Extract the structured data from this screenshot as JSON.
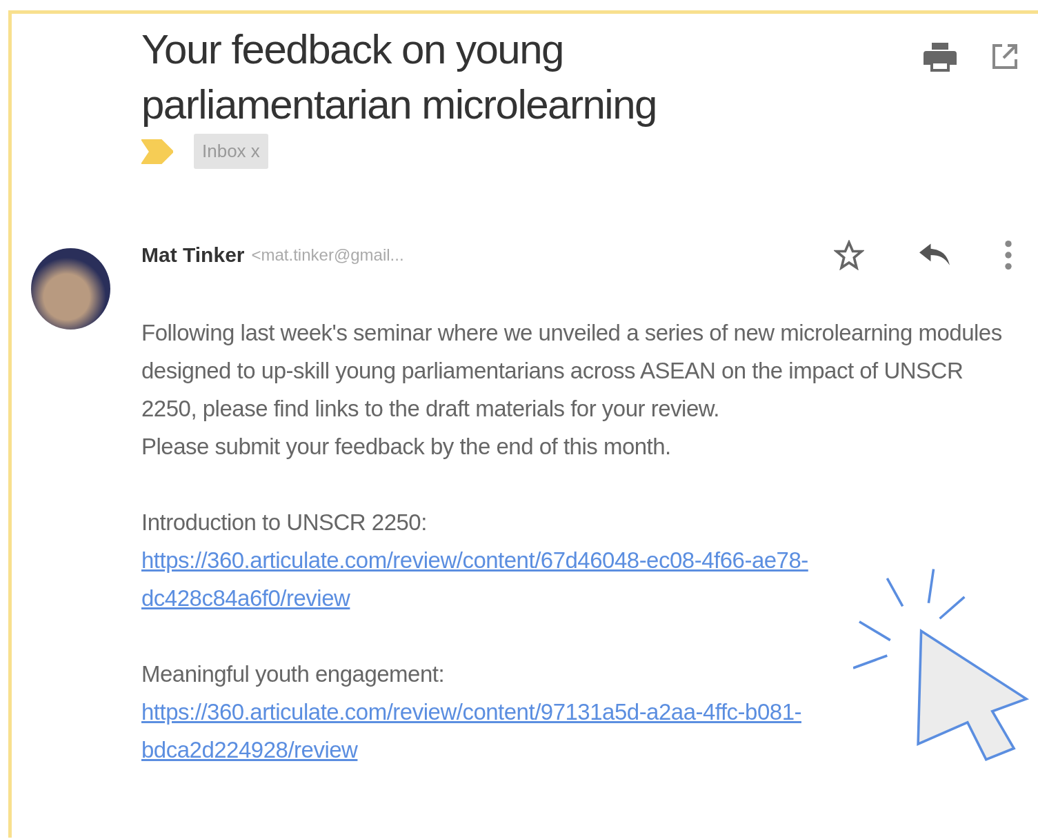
{
  "email": {
    "subject": "Your feedback on young parliamentarian microlearning",
    "important": true,
    "labels": [
      {
        "text": "Inbox",
        "close": "x"
      }
    ],
    "sender": {
      "name": "Mat Tinker",
      "address": "<mat.tinker@gmail..."
    },
    "starred": false,
    "body": [
      "Following last week's seminar where we unveiled a series of new microlearning modules designed to up-skill young parliamentarians across ASEAN on the impact of UNSCR 2250, please find links to the draft materials for your review.",
      "Please submit your feedback by the end of this month."
    ],
    "links": [
      {
        "title": "Introduction to UNSCR 2250:",
        "url": "https://360.articulate.com/review/content/67d46048-ec08-4f66-ae78-dc428c84a6f0/review"
      },
      {
        "title": "Meaningful youth engagement:",
        "url": "https://360.articulate.com/review/content/97131a5d-a2aa-4ffc-b081-bdca2d224928/review"
      }
    ]
  }
}
